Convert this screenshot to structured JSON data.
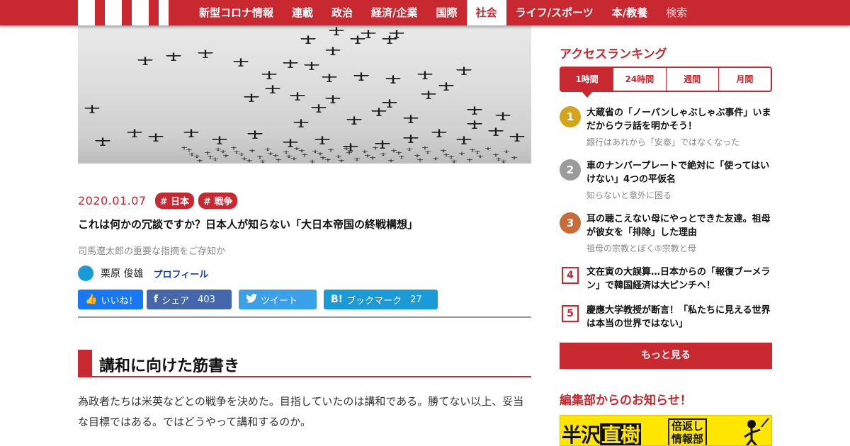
{
  "nav": {
    "items": [
      {
        "label": "新型コロナ情報"
      },
      {
        "label": "連載"
      },
      {
        "label": "政治"
      },
      {
        "label": "経済/企業"
      },
      {
        "label": "国際"
      },
      {
        "label": "社会",
        "active": true
      },
      {
        "label": "ライフ/スポーツ"
      },
      {
        "label": "本/教養"
      },
      {
        "label": "検索"
      }
    ]
  },
  "article": {
    "date": "2020.01.07",
    "tags": [
      "# 日本",
      "# 戦争"
    ],
    "title": "これは何かの冗談ですか？日本人が知らない「大日本帝国の終戦構想」",
    "subtitle": "司馬遼太郎の重要な指摘をご存知か",
    "author": "栗原 俊雄",
    "profile_label": "プロフィール",
    "share": {
      "like": "いいね！",
      "facebook_label": "シェア",
      "facebook_count": "403",
      "twitter_label": "ツイート",
      "hatena_label": "ブックマーク",
      "hatena_count": "27"
    },
    "section_heading": "講和に向けた筋書き",
    "body": "為政者たちは米英などとの戦争を決めた。目指していたのは講和である。勝てない以上、妥当な目標ではある。ではどうやって講和するのか。"
  },
  "sidebar": {
    "ranking_title": "アクセスランキング",
    "tabs": [
      "1時間",
      "24時間",
      "週間",
      "月間"
    ],
    "active_tab": "1時間",
    "rankings": [
      {
        "num": "1",
        "title": "大蔵省の「ノーパンしゃぶしゃぶ事件」いまだからウラ話を明かそう！",
        "sub": "銀行はあれから「安泰」ではなくなった"
      },
      {
        "num": "2",
        "title": "車のナンバープレートで絶対に「使ってはいけない」4つの平仮名",
        "sub": "知らないと意外に困る"
      },
      {
        "num": "3",
        "title": "耳の聴こえない母にやっとできた友達。祖母が彼女を「排除」した理由",
        "sub": "祖母の宗教とぼく⑤宗教と母"
      },
      {
        "num": "4",
        "title": "文在寅の大誤算…日本からの「報復ブーメラン」で韓国経済は大ピンチへ！",
        "sub": ""
      },
      {
        "num": "5",
        "title": "慶應大学教授が断言！「私たちに見える世界は本当の世界ではない」",
        "sub": ""
      }
    ],
    "more_label": "もっと見る",
    "notice_title": "編集部からのお知らせ！",
    "banner": {
      "main_a": "半沢",
      "main_b": "直樹",
      "side": "倍返し\n情報部"
    }
  },
  "colors": {
    "accent": "#c8282f",
    "gold": "#d4a51c",
    "silver": "#9b9b9b",
    "bronze": "#c86a3a"
  }
}
